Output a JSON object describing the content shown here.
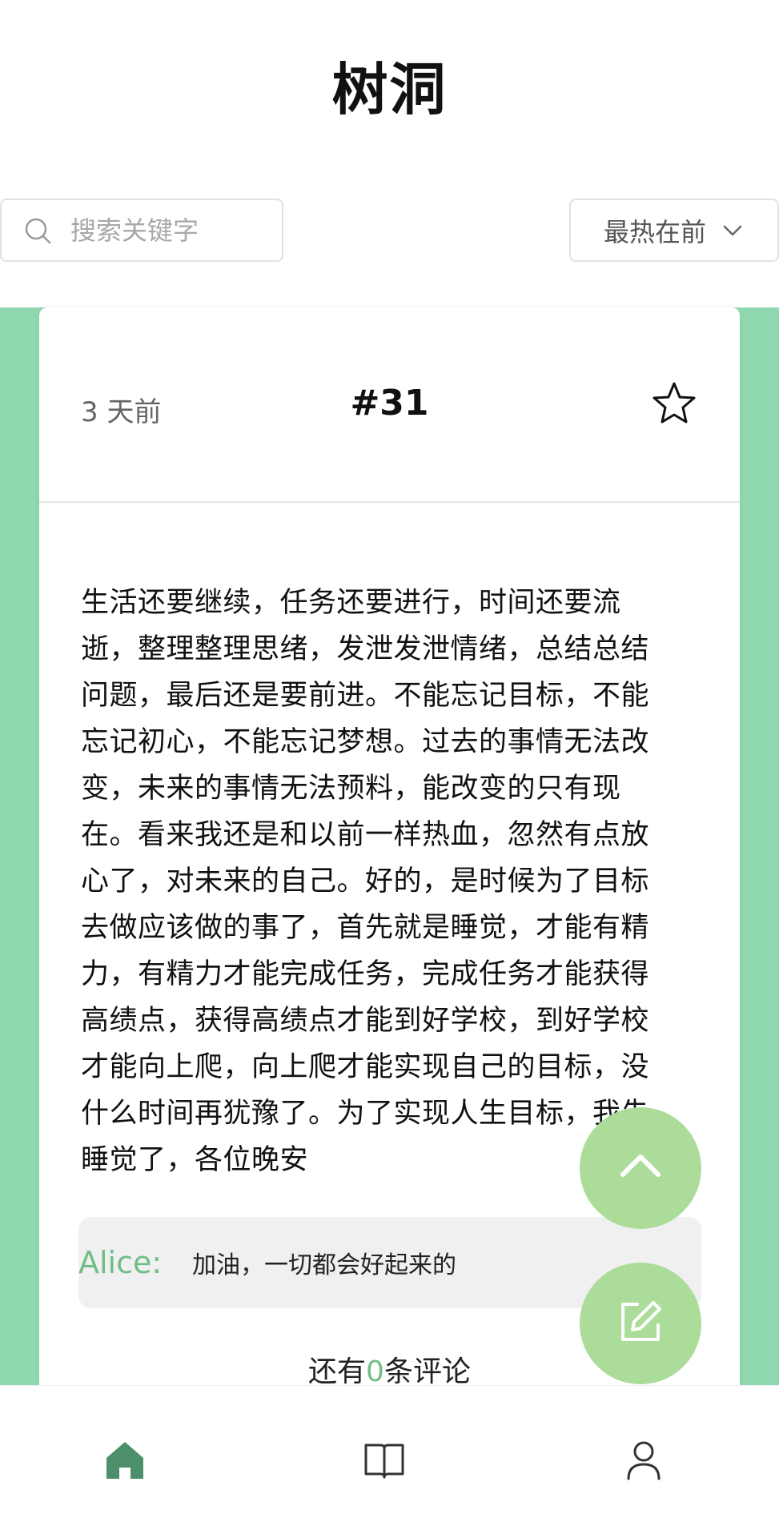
{
  "header": {
    "title": "树洞"
  },
  "toolbar": {
    "search_placeholder": "搜索关键字",
    "sort_label": "最热在前"
  },
  "post": {
    "time": "3 天前",
    "id_label": "#31",
    "content": "生活还要继续，任务还要进行，时间还要流\n逝，整理整理思绪，发泄发泄情绪，总结总结\n问题，最后还是要前进。不能忘记目标，不能\n忘记初心，不能忘记梦想。过去的事情无法改\n变，未来的事情无法预料，能改变的只有现\n在。看来我还是和以前一样热血，忽然有点放\n心了，对未来的自己。好的，是时候为了目标\n去做应该做的事了，首先就是睡觉，才能有精\n力，有精力才能完成任务，完成任务才能获得\n高绩点，获得高绩点才能到好学校，到好学校\n才能向上爬，向上爬才能实现自己的目标，没\n什么时间再犹豫了。为了实现人生目标，我先\n睡觉了，各位晚安",
    "comment": {
      "author": "Alice:",
      "text": "加油，一切都会好起来的"
    },
    "remaining_prefix": "还有",
    "remaining_count": "0",
    "remaining_suffix": "条评论"
  },
  "colors": {
    "accent": "#8fd8b0",
    "fab": "#acdc9a",
    "highlight": "#6fbf85",
    "nav_active": "#4e8f6b"
  },
  "icons": {
    "search": "search-icon",
    "sort": "chevron-down-icon",
    "favorite": "star-icon",
    "scroll_top": "chevron-up-icon",
    "compose": "edit-icon",
    "nav_home": "home-icon",
    "nav_book": "book-icon",
    "nav_user": "user-icon"
  }
}
